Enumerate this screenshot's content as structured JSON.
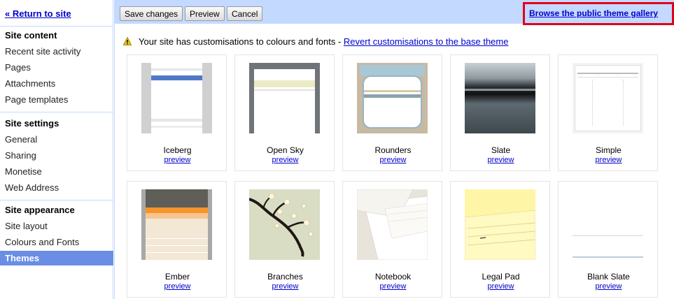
{
  "sidebar": {
    "return_link": "« Return to site",
    "sections": [
      {
        "heading": "Site content",
        "items": [
          "Recent site activity",
          "Pages",
          "Attachments",
          "Page templates"
        ]
      },
      {
        "heading": "Site settings",
        "items": [
          "General",
          "Sharing",
          "Monetise",
          "Web Address"
        ]
      },
      {
        "heading": "Site appearance",
        "items": [
          "Site layout",
          "Colours and Fonts"
        ]
      }
    ],
    "active_item": "Themes"
  },
  "toolbar": {
    "save_label": "Save changes",
    "preview_label": "Preview",
    "cancel_label": "Cancel",
    "gallery_link": "Browse the public theme gallery"
  },
  "notice": {
    "icon": "warning-icon",
    "text": "Your site has customisations to colours and fonts - ",
    "link": "Revert customisations to the base theme"
  },
  "themes": [
    {
      "name": "Iceberg",
      "preview": "preview"
    },
    {
      "name": "Open Sky",
      "preview": "preview"
    },
    {
      "name": "Rounders",
      "preview": "preview"
    },
    {
      "name": "Slate",
      "preview": "preview"
    },
    {
      "name": "Simple",
      "preview": "preview"
    },
    {
      "name": "Ember",
      "preview": "preview"
    },
    {
      "name": "Branches",
      "preview": "preview"
    },
    {
      "name": "Notebook",
      "preview": "preview"
    },
    {
      "name": "Legal Pad",
      "preview": "preview"
    },
    {
      "name": "Blank Slate",
      "preview": "preview"
    }
  ],
  "colors": {
    "accent": "#c3d9ff",
    "active": "#6a8ee6",
    "link": "#0000cc",
    "highlight": "#e1001a"
  }
}
